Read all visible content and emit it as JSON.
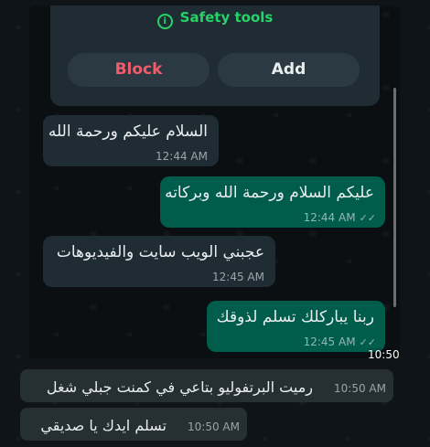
{
  "image_message": {
    "safety": {
      "icon": "info-icon",
      "label": "Safety tools"
    },
    "block_label": "Block",
    "add_label": "Add",
    "bubbles": [
      {
        "direction": "incoming",
        "text": "السلام عليكم ورحمة الله",
        "time": "12:44 AM"
      },
      {
        "direction": "outgoing",
        "text": "عليكم السلام ورحمة الله وبركاته",
        "time": "12:44 AM"
      },
      {
        "direction": "incoming",
        "text": "عجبني الويب سايت والفيديوهات",
        "time": "12:45 AM"
      },
      {
        "direction": "outgoing",
        "text": "ربنا يباركلك تسلم لذوقك",
        "time": "12:45 AM"
      }
    ],
    "time": "10:50 AM"
  },
  "messages": [
    {
      "text": "رميت البرتفوليو بتاعي في كمنت جبلي شغل",
      "time": "10:50 AM"
    },
    {
      "text": "تسلم ايدك يا صديقي",
      "time": "10:50 AM"
    }
  ],
  "colors": {
    "safety_green": "#25d366",
    "block_red": "#f15c6d",
    "incoming_bubble": "#1f2c34",
    "outgoing_bubble": "#005c4b",
    "chat_bubble": "#262f34"
  }
}
